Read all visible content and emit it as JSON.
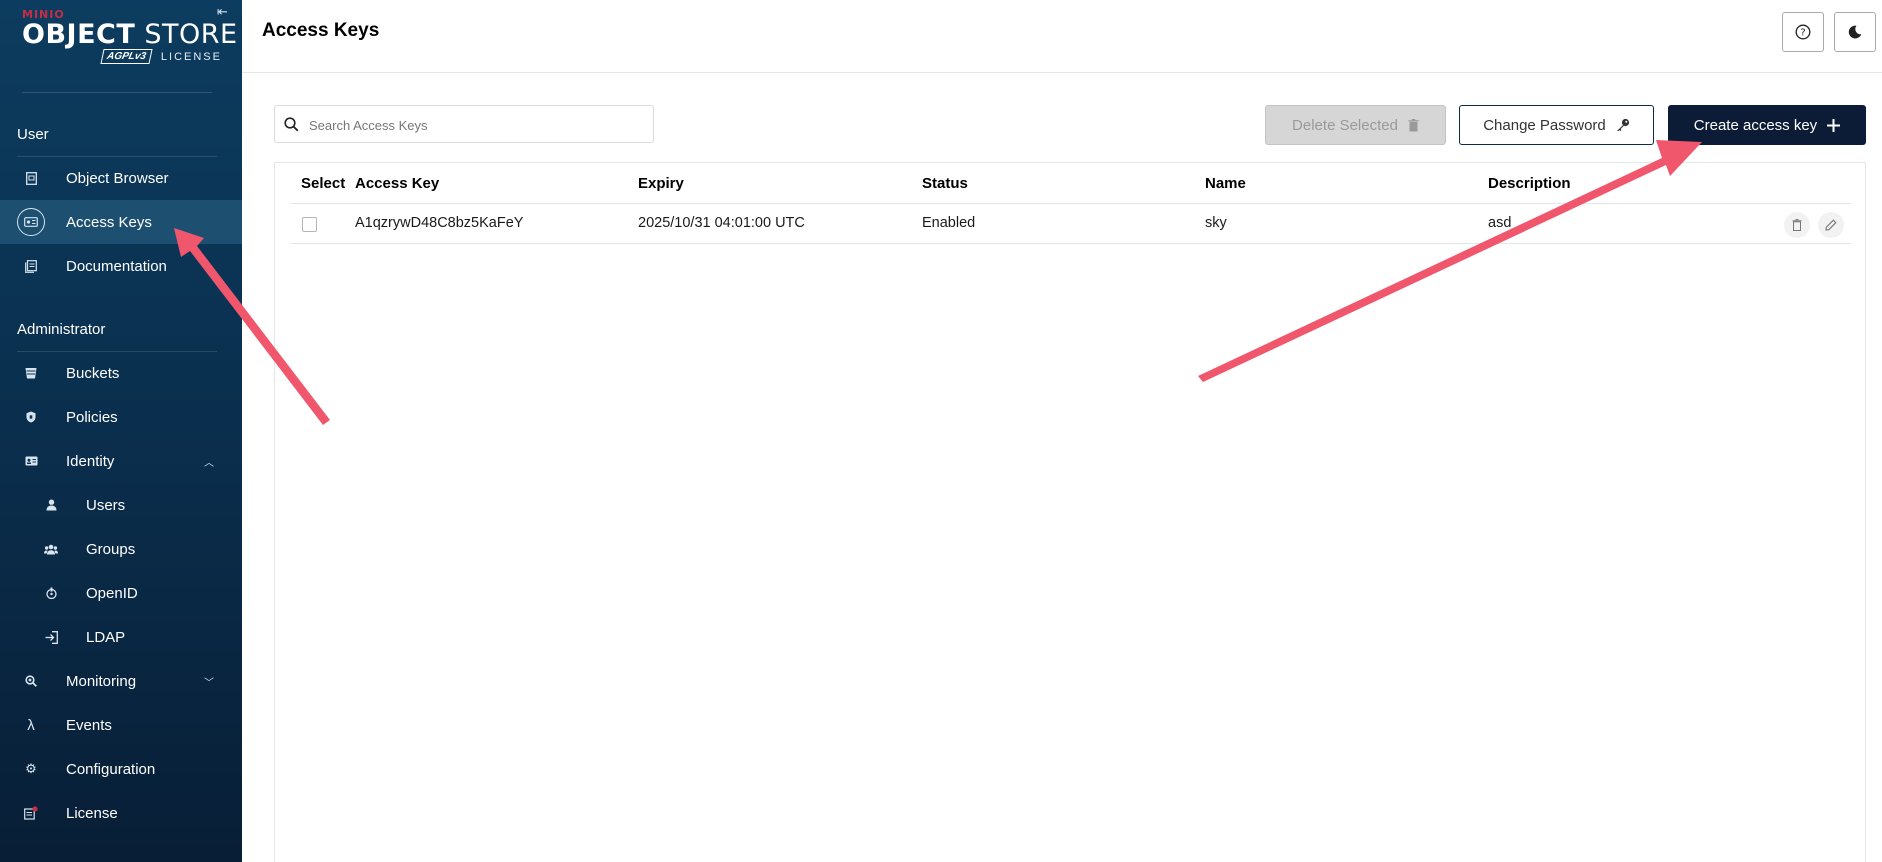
{
  "brand": {
    "minio": "MINIO",
    "product_bold": "OBJECT",
    "product_light": " STORE",
    "agpl": "AGPLv3",
    "license": "LICENSE"
  },
  "sidebar": {
    "user_section": "User",
    "admin_section": "Administrator",
    "user_items": [
      {
        "label": "Object Browser",
        "icon": "object-browser-icon"
      },
      {
        "label": "Access Keys",
        "icon": "access-keys-icon",
        "active": true
      },
      {
        "label": "Documentation",
        "icon": "documentation-icon"
      }
    ],
    "admin_items": [
      {
        "label": "Buckets",
        "icon": "bucket-icon"
      },
      {
        "label": "Policies",
        "icon": "policy-shield-icon"
      },
      {
        "label": "Identity",
        "icon": "identity-card-icon",
        "expanded": true
      },
      {
        "label": "Users",
        "icon": "user-icon"
      },
      {
        "label": "Groups",
        "icon": "groups-icon"
      },
      {
        "label": "OpenID",
        "icon": "openid-icon"
      },
      {
        "label": "LDAP",
        "icon": "ldap-login-icon"
      },
      {
        "label": "Monitoring",
        "icon": "monitoring-search-icon",
        "expanded": false
      },
      {
        "label": "Events",
        "icon": "lambda-icon"
      },
      {
        "label": "Configuration",
        "icon": "gear-icon"
      },
      {
        "label": "License",
        "icon": "license-icon"
      }
    ]
  },
  "header": {
    "title": "Access Keys",
    "help_icon": "help-circle-icon",
    "theme_icon": "moon-icon"
  },
  "toolbar": {
    "search_placeholder": "Search Access Keys",
    "delete_label": "Delete Selected",
    "change_password_label": "Change Password",
    "create_label": "Create access key"
  },
  "table": {
    "columns": [
      "Select",
      "Access Key",
      "Expiry",
      "Status",
      "Name",
      "Description"
    ],
    "rows": [
      {
        "access_key": "A1qzrywD48C8bz5KaFeY",
        "expiry": "2025/10/31 04:01:00 UTC",
        "status": "Enabled",
        "name": "sky",
        "description": "asd",
        "selected": false
      }
    ]
  },
  "colors": {
    "sidebar_top": "#0c3c5f",
    "sidebar_bottom": "#081e36",
    "active_item": "#1d4f70",
    "primary_button": "#0c1c37",
    "minio_red": "#c72c48",
    "annotation_arrow": "#f0566c"
  }
}
